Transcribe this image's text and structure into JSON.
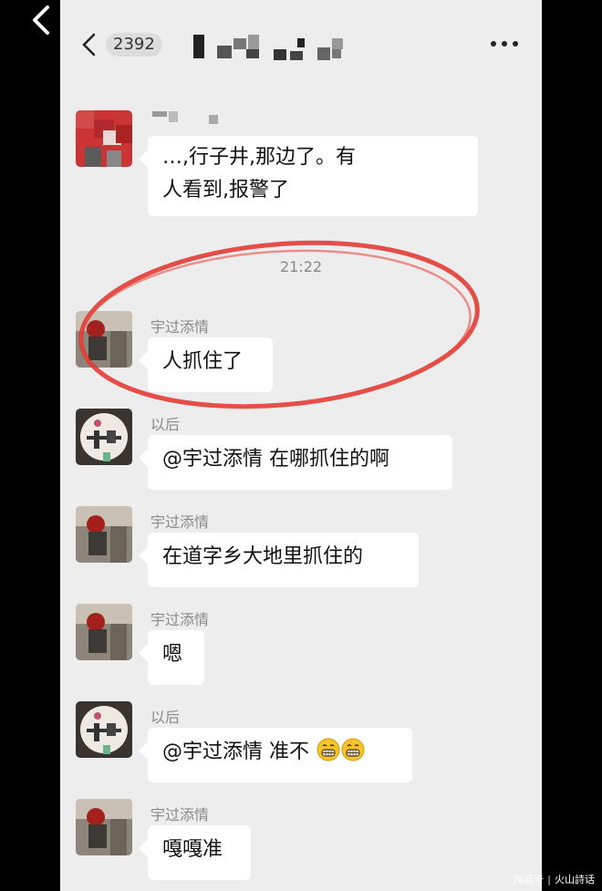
{
  "header": {
    "unread_count": "2392",
    "back_icon": "chevron-left-icon",
    "more_icon": "ellipsis-icon"
  },
  "messages": [
    {
      "sender": "",
      "text": "…,行子井,那边了。有人看到,报警了",
      "text_line1": "…,行子井,那边了。有",
      "text_line2": "人看到,报警了"
    },
    {
      "sender": "宇过添情",
      "text": "人抓住了"
    },
    {
      "sender": "以后",
      "text": "@宇过添情  在哪抓住的啊"
    },
    {
      "sender": "宇过添情",
      "text": "在道字乡大地里抓住的"
    },
    {
      "sender": "宇过添情",
      "text": "嗯"
    },
    {
      "sender": "以后",
      "text": "@宇过添情  准不"
    },
    {
      "sender": "宇过添情",
      "text": "嘎嘎准"
    }
  ],
  "timestamp": "21:22",
  "watermark": {
    "left": "网易号",
    "right": "火山詩话"
  },
  "colors": {
    "chat_bg": "#ededed",
    "bubble": "#ffffff",
    "annotation": "#e0312a"
  }
}
